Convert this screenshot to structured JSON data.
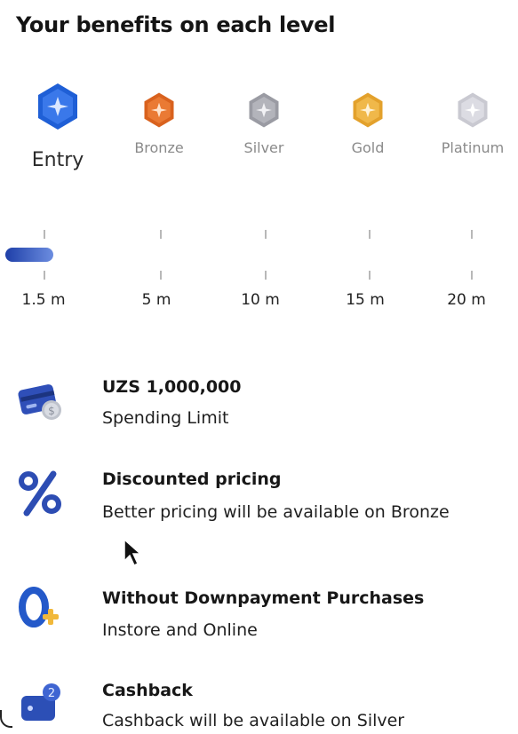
{
  "page": {
    "title": "Your benefits on each level"
  },
  "levels": [
    {
      "name": "Entry",
      "color": "#1f5fd6",
      "active": true
    },
    {
      "name": "Bronze",
      "color": "#d9621e",
      "active": false
    },
    {
      "name": "Silver",
      "color": "#9a9ba3",
      "active": false
    },
    {
      "name": "Gold",
      "color": "#e3a12c",
      "active": false
    },
    {
      "name": "Platinum",
      "color": "#c9c9d1",
      "active": false
    }
  ],
  "scale": {
    "ticks": [
      "1.5 m",
      "5 m",
      "10 m",
      "15 m",
      "20 m"
    ],
    "progress_fraction": 0.0,
    "progress_color": "#2a4bb5"
  },
  "benefits": [
    {
      "icon": "credit-card-coin-icon",
      "title": "UZS 1,000,000",
      "desc": "Spending Limit"
    },
    {
      "icon": "percent-icon",
      "title": "Discounted pricing",
      "desc": "Better pricing will be available on Bronze"
    },
    {
      "icon": "zero-plus-icon",
      "title": "Without Downpayment Purchases",
      "desc": "Instore and Online"
    },
    {
      "icon": "wallet-cashback-icon",
      "title": "Cashback",
      "desc": "Cashback will be available on Silver"
    }
  ]
}
